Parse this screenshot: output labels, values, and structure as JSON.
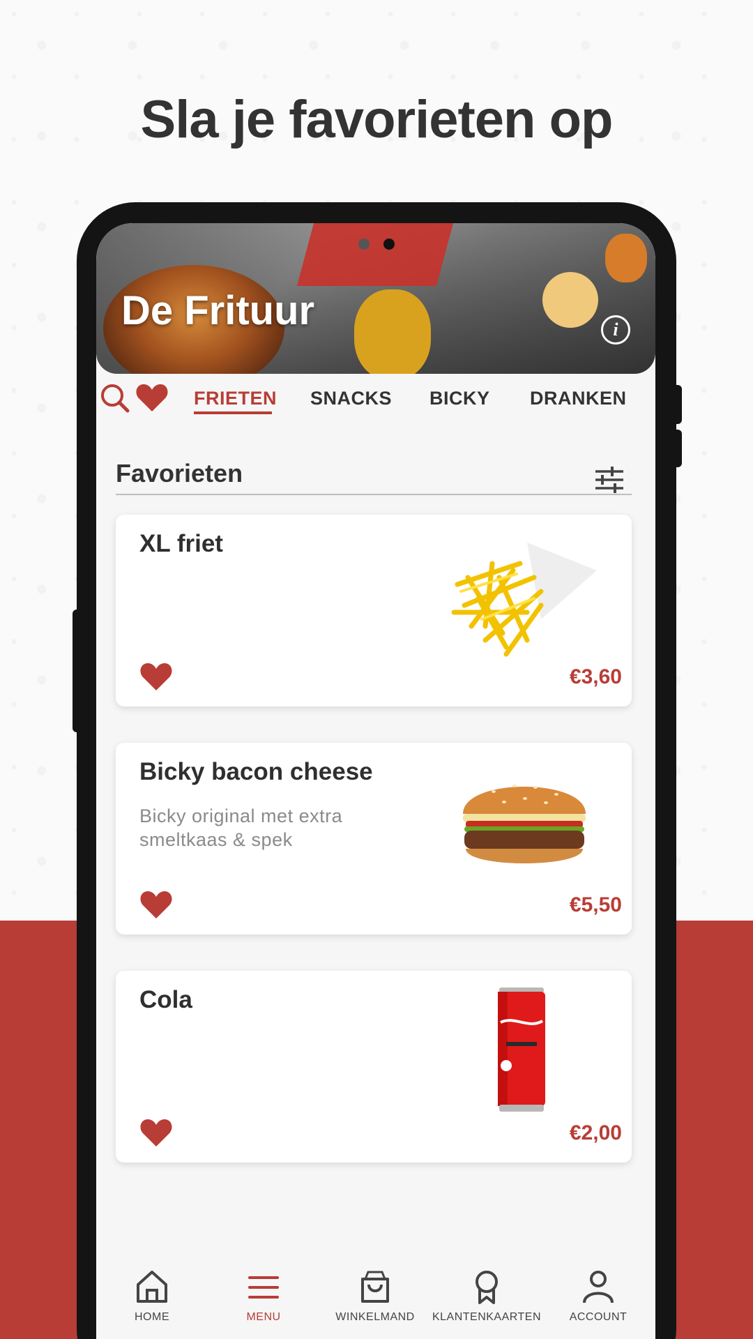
{
  "headline": "Sla je favorieten op",
  "shop": {
    "name": "De Frituur",
    "info_icon": "i"
  },
  "categories": [
    {
      "label": "FRIETEN",
      "active": true
    },
    {
      "label": "SNACKS",
      "active": false
    },
    {
      "label": "BICKY",
      "active": false
    },
    {
      "label": "DRANKEN",
      "active": false
    }
  ],
  "favorites": {
    "title": "Favorieten",
    "items": [
      {
        "name": "XL friet",
        "description": "",
        "price": "€3,60",
        "image": "fries-image"
      },
      {
        "name": "Bicky bacon cheese",
        "description": "Bicky original met extra smeltkaas & spek",
        "price": "€5,50",
        "image": "burger-image"
      },
      {
        "name": "Cola",
        "description": "",
        "price": "€2,00",
        "image": "cola-can-image"
      }
    ]
  },
  "nav": {
    "home": "HOME",
    "menu": "MENU",
    "cart": "WINKELMAND",
    "cards": "KLANTENKAARTEN",
    "account": "ACCOUNT"
  },
  "colors": {
    "accent": "#b83d36",
    "text": "#333333",
    "frame": "#141414"
  },
  "icons": [
    "search-icon",
    "heart-icon",
    "filter-icon",
    "info-icon",
    "home-icon",
    "menu-icon",
    "bag-icon",
    "award-icon",
    "user-icon"
  ]
}
